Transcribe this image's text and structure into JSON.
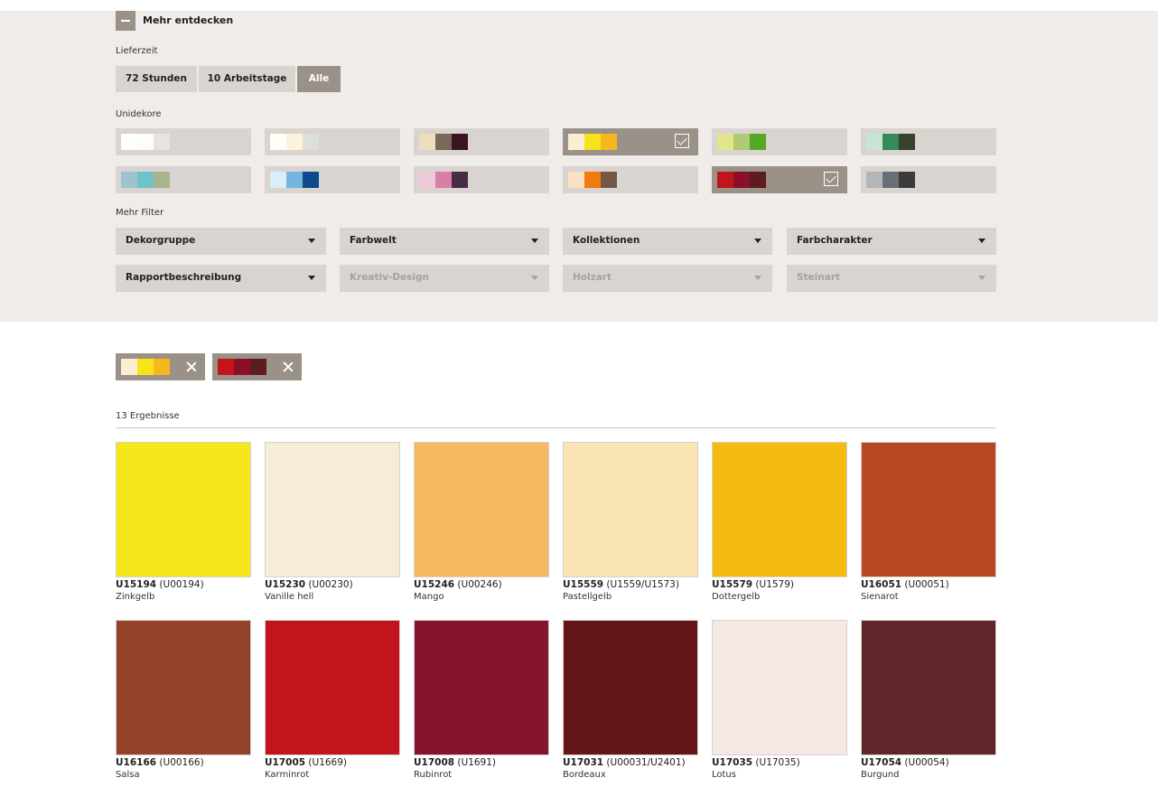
{
  "toggle": {
    "label": "Mehr entdecken"
  },
  "lieferzeit": {
    "label": "Lieferzeit",
    "options": [
      "72 Stunden",
      "10 Arbeitstage",
      "Alle"
    ],
    "active": "Alle"
  },
  "unidekore": {
    "label": "Unidekore",
    "swatches": [
      {
        "colors": [
          "#ffffff",
          "#fdfdfb",
          "#e6e4e0"
        ],
        "selected": false
      },
      {
        "colors": [
          "#fffef8",
          "#fcf3dc",
          "#dde0d7"
        ],
        "selected": false
      },
      {
        "colors": [
          "#efdcbd",
          "#776a5b",
          "#3b1520"
        ],
        "selected": false
      },
      {
        "colors": [
          "#fbefd3",
          "#f7e31a",
          "#f8b81d"
        ],
        "selected": true
      },
      {
        "colors": [
          "#e4e48b",
          "#b0c878",
          "#57a727"
        ],
        "selected": false
      },
      {
        "colors": [
          "#c6e5d2",
          "#348a5b",
          "#38402e"
        ],
        "selected": false
      },
      {
        "colors": [
          "#9fc3cc",
          "#6cc3c8",
          "#a6b58b"
        ],
        "selected": false
      },
      {
        "colors": [
          "#d8eef8",
          "#74b5e1",
          "#0f4b8c"
        ],
        "selected": false
      },
      {
        "colors": [
          "#ecc8d8",
          "#d97ea4",
          "#4a2b45"
        ],
        "selected": false
      },
      {
        "colors": [
          "#f8e2c2",
          "#ef7a10",
          "#735846"
        ],
        "selected": false
      },
      {
        "colors": [
          "#c4141b",
          "#8a1029",
          "#5d1c1e"
        ],
        "selected": true
      },
      {
        "colors": [
          "#b3b6b9",
          "#6a6e78",
          "#3a3a38"
        ],
        "selected": false
      }
    ]
  },
  "mehr_filter": {
    "label": "Mehr Filter",
    "dropdowns": [
      {
        "label": "Dekorgruppe",
        "disabled": false
      },
      {
        "label": "Farbwelt",
        "disabled": false
      },
      {
        "label": "Kollektionen",
        "disabled": false
      },
      {
        "label": "Farbcharakter",
        "disabled": false
      },
      {
        "label": "Rapportbeschreibung",
        "disabled": false
      },
      {
        "label": "Kreativ-Design",
        "disabled": true
      },
      {
        "label": "Holzart",
        "disabled": true
      },
      {
        "label": "Steinart",
        "disabled": true
      }
    ]
  },
  "active_filters": [
    {
      "colors": [
        "#fbefd3",
        "#f7e31a",
        "#f8b81d"
      ]
    },
    {
      "colors": [
        "#c4141b",
        "#8a1029",
        "#5d1c1e"
      ]
    }
  ],
  "results": {
    "count_label": "13 Ergebnisse",
    "items": [
      {
        "code": "U15194",
        "alt": "(U00194)",
        "name": "Zinkgelb",
        "color": "#f6e71a"
      },
      {
        "code": "U15230",
        "alt": "(U00230)",
        "name": "Vanille hell",
        "color": "#f7ecd8"
      },
      {
        "code": "U15246",
        "alt": "(U00246)",
        "name": "Mango",
        "color": "#f6b861"
      },
      {
        "code": "U15559",
        "alt": "(U1559/U1573)",
        "name": "Pastellgelb",
        "color": "#fae4b3"
      },
      {
        "code": "U15579",
        "alt": "(U1579)",
        "name": "Dottergelb",
        "color": "#f6bb10"
      },
      {
        "code": "U16051",
        "alt": "(U00051)",
        "name": "Sienarot",
        "color": "#b84821"
      },
      {
        "code": "U16166",
        "alt": "(U00166)",
        "name": "Salsa",
        "color": "#94432b"
      },
      {
        "code": "U17005",
        "alt": "(U1669)",
        "name": "Karminrot",
        "color": "#c1141d"
      },
      {
        "code": "U17008",
        "alt": "(U1691)",
        "name": "Rubinrot",
        "color": "#84132e"
      },
      {
        "code": "U17031",
        "alt": "(U00031/U2401)",
        "name": "Bordeaux",
        "color": "#651717"
      },
      {
        "code": "U17035",
        "alt": "(U17035)",
        "name": "Lotus",
        "color": "#f6e9e3"
      },
      {
        "code": "U17054",
        "alt": "(U00054)",
        "name": "Burgund",
        "color": "#60272b"
      }
    ]
  }
}
